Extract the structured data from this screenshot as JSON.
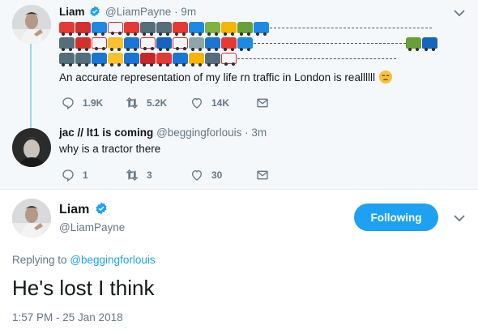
{
  "tweet1": {
    "name": "Liam",
    "handle": "@LiamPayne",
    "time": "· 9m",
    "text": "An accurate representation of my life rn traffic in London is reallllll",
    "emoji_rows": [
      [
        "car-red",
        "bus-red",
        "car-blue",
        "ambulance",
        "police-light",
        "motorbike",
        "motorbike",
        "car-red",
        "car-blue",
        "truck-green",
        "bus-yellow",
        "tractor",
        "car-blue"
      ],
      [
        "motorbike",
        "bus-red",
        "ambulance",
        "taxi",
        "bus-blue",
        "ambulance",
        "police-car",
        "ambulance",
        "scooter",
        "bus-blue",
        "car-red",
        "car-blue"
      ],
      [
        "motorbike",
        "motorbike",
        "bus-blue",
        "taxi",
        "bus-blue",
        "fire-truck",
        "car-red",
        "bus-blue",
        "bus-yellow",
        "motorbike",
        "ambulance"
      ]
    ],
    "end_vehicles": [
      "tractor",
      "truck-blue"
    ],
    "stats": {
      "replies": "1.9K",
      "retweets": "5.2K",
      "likes": "14K"
    }
  },
  "tweet2": {
    "name": "jac // lt1 is coming",
    "handle": "@beggingforlouis",
    "time": "· 3m",
    "text": "why is a tractor there",
    "stats": {
      "replies": "1",
      "retweets": "3",
      "likes": "30"
    }
  },
  "main": {
    "name": "Liam",
    "handle": "@LiamPayne",
    "follow_label": "Following",
    "replying_prefix": "Replying to",
    "replying_to": "@beggingforlouis",
    "text": "He's lost I think",
    "timestamp": "1:57 PM - 25 Jan 2018"
  },
  "colors": {
    "accent": "#1da1f2",
    "muted": "#657786",
    "thread_line": "#9fd3f5",
    "panel_bg": "#f5f8fa"
  }
}
